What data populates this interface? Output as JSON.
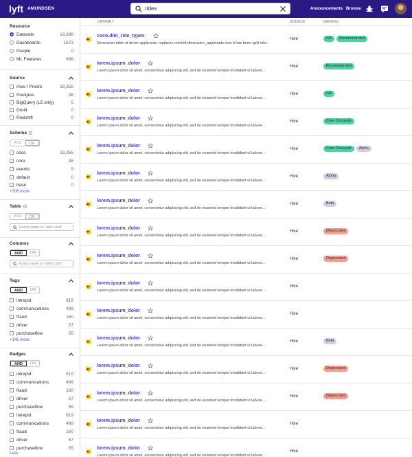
{
  "header": {
    "brand": "AMUNDSEN",
    "search_value": "rides",
    "nav": [
      "Announcements",
      "Browse"
    ]
  },
  "sidebar": {
    "resource": {
      "title": "Resource",
      "items": [
        {
          "label": "Datasets",
          "count": "19,398",
          "selected": true
        },
        {
          "label": "Dashboards",
          "count": "1673",
          "selected": false
        },
        {
          "label": "People",
          "count": "0",
          "selected": false
        },
        {
          "label": "ML Features",
          "count": "698",
          "selected": false
        }
      ]
    },
    "source": {
      "title": "Source",
      "items": [
        {
          "label": "Hive / Presto",
          "count": "19,355"
        },
        {
          "label": "Postgres",
          "count": "38"
        },
        {
          "label": "BigQuery (L5 only)",
          "count": "5"
        },
        {
          "label": "Druid",
          "count": "0"
        },
        {
          "label": "Redshift",
          "count": "0"
        }
      ]
    },
    "schema": {
      "title": "Schema",
      "and": "AND",
      "or": "OR",
      "items": [
        {
          "label": "coco",
          "count": "19,355"
        },
        {
          "label": "core",
          "count": "38"
        },
        {
          "label": "events",
          "count": "5"
        },
        {
          "label": "default",
          "count": "0"
        },
        {
          "label": "base",
          "count": "0"
        }
      ],
      "more": "+206 more"
    },
    "table": {
      "title": "Table",
      "and": "AND",
      "or": "OR",
      "placeholder": "Exact name or \"wild card\""
    },
    "columns": {
      "title": "Columns",
      "and": "AND",
      "or": "OR",
      "placeholder": "Exact name or \"wild card\""
    },
    "tags": {
      "title": "Tags",
      "and": "AND",
      "or": "OR",
      "items": [
        {
          "label": "intrepid",
          "count": "819"
        },
        {
          "label": "communications",
          "count": "499"
        },
        {
          "label": "fraud",
          "count": "160"
        },
        {
          "label": "driver",
          "count": "57"
        },
        {
          "label": "purchaseflow",
          "count": "55"
        }
      ],
      "more": "+145 more"
    },
    "badges": {
      "title": "Badges",
      "and": "AND",
      "or": "OR",
      "items": [
        {
          "label": "intrepid",
          "count": "819"
        },
        {
          "label": "communications",
          "count": "499"
        },
        {
          "label": "fraud",
          "count": "160"
        },
        {
          "label": "driver",
          "count": "57"
        },
        {
          "label": "purchaseflow",
          "count": "55"
        },
        {
          "label": "intrepid",
          "count": "819"
        },
        {
          "label": "communications",
          "count": "499"
        },
        {
          "label": "fraud",
          "count": "160"
        },
        {
          "label": "driver",
          "count": "57"
        },
        {
          "label": "purchaseflow",
          "count": "55"
        }
      ],
      "less": "Less"
    }
  },
  "table": {
    "columns": [
      "DATASET",
      "SOURCE",
      "BADGES"
    ],
    "badge_colors": {
      "GA": "#4fd1a5",
      "Recommended": "#4fd1a5",
      "Core Concepts": "#4fd1a5",
      "Alpha": "#d0cfe0",
      "Beta": "#d0cfe0",
      "Deprecated": "#f2a08c"
    },
    "rows": [
      {
        "name": "coco.dim_ride_types",
        "desc": "Dimension table of driver applicants, replaces redshift.dimension_applicants now it has been split into...",
        "source": "Hive",
        "badges": [
          "GA",
          "Recommended"
        ]
      },
      {
        "name": "lorem.ipsum_dolor",
        "desc": "Lorem ipsum dolor sit amet, consectetur adipiscing elit, sed do eiusmod tempor incididunt ut labore...",
        "source": "Hive",
        "badges": [
          "Recommended"
        ]
      },
      {
        "name": "lorem.ipsum_dolor",
        "desc": "Lorem ipsum dolor sit amet, consectetur adipiscing elit, sed do eiusmod tempor incididunt ut labore...",
        "source": "Hive",
        "badges": [
          "GA"
        ]
      },
      {
        "name": "lorem.ipsum_dolor",
        "desc": "Lorem ipsum dolor sit amet, consectetur adipiscing elit, sed do eiusmod tempor incididunt ut labore...",
        "source": "Hive",
        "badges": [
          "Core Concepts"
        ]
      },
      {
        "name": "lorem.ipsum_dolor",
        "desc": "Lorem ipsum dolor sit amet, consectetur adipiscing elit, sed do eiusmod tempor incididunt ut labore...",
        "source": "Hive",
        "badges": [
          "Core Concepts",
          "Alpha"
        ]
      },
      {
        "name": "lorem.ipsum_dolor",
        "desc": "Lorem ipsum dolor sit amet, consectetur adipiscing elit, sed do eiusmod tempor incididunt ut labore...",
        "source": "Hive",
        "badges": [
          "Alpha"
        ]
      },
      {
        "name": "lorem.ipsum_dolor",
        "desc": "Lorem ipsum dolor sit amet, consectetur adipiscing elit, sed do eiusmod tempor incididunt ut labore...",
        "source": "Hive",
        "badges": [
          "Beta"
        ]
      },
      {
        "name": "lorem.ipsum_dolor",
        "desc": "Lorem ipsum dolor sit amet, consectetur adipiscing elit, sed do eiusmod tempor incididunt ut labore...",
        "source": "Hive",
        "badges": [
          "Deprecated"
        ]
      },
      {
        "name": "lorem.ipsum_dolor",
        "desc": "Lorem ipsum dolor sit amet, consectetur adipiscing elit, sed do eiusmod tempor incididunt ut labore...",
        "source": "Hive",
        "badges": [
          "Deprecated"
        ]
      },
      {
        "name": "lorem.ipsum_dolor",
        "desc": "Lorem ipsum dolor sit amet, consectetur adipiscing elit, sed do eiusmod tempor incididunt ut labore...",
        "source": "Hive",
        "badges": []
      },
      {
        "name": "lorem.ipsum_dolor",
        "desc": "Lorem ipsum dolor sit amet, consectetur adipiscing elit, sed do eiusmod tempor incididunt ut labore...",
        "source": "Hive",
        "badges": []
      },
      {
        "name": "lorem.ipsum_dolor",
        "desc": "Lorem ipsum dolor sit amet, consectetur adipiscing elit, sed do eiusmod tempor incididunt ut labore...",
        "source": "Hive",
        "badges": [
          "Beta"
        ]
      },
      {
        "name": "lorem.ipsum_dolor",
        "desc": "Lorem ipsum dolor sit amet, consectetur adipiscing elit, sed do eiusmod tempor incididunt ut labore...",
        "source": "Hive",
        "badges": [
          "Deprecated"
        ]
      },
      {
        "name": "lorem.ipsum_dolor",
        "desc": "Lorem ipsum dolor sit amet, consectetur adipiscing elit, sed do eiusmod tempor incididunt ut labore...",
        "source": "Hive",
        "badges": [
          "Deprecated"
        ]
      },
      {
        "name": "lorem.ipsum_dolor",
        "desc": "Lorem ipsum dolor sit amet, consectetur adipiscing elit, sed do eiusmod tempor incididunt ut labore...",
        "source": "Hive",
        "badges": []
      },
      {
        "name": "lorem.ipsum_dolor",
        "desc": "Lorem ipsum dolor sit amet, consectetur adipiscing elit, sed do eiusmod tempor incididunt ut labore...",
        "source": "Hive",
        "badges": []
      }
    ]
  }
}
